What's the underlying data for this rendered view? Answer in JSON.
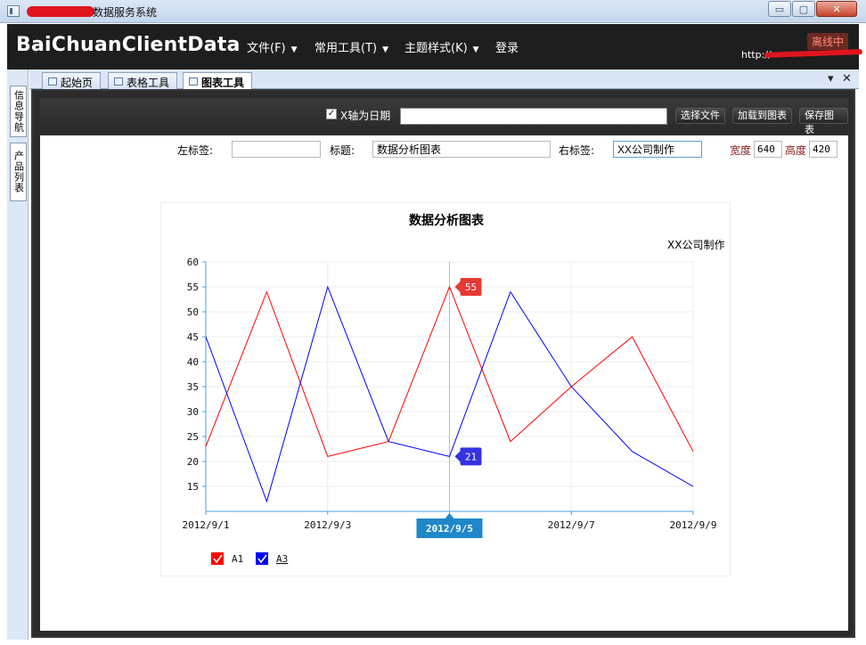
{
  "window": {
    "title": "数据服务系统",
    "min_glyph": "▭",
    "max_glyph": "▢",
    "close_glyph": "✕"
  },
  "header": {
    "brand": "BaiChuanClientData",
    "menus": [
      {
        "label": "文件(F)"
      },
      {
        "label": "常用工具(T)"
      },
      {
        "label": "主题样式(K)"
      },
      {
        "label": "登录"
      }
    ],
    "status": "离线中",
    "url_prefix": "http://"
  },
  "left_tabs": [
    {
      "label": "信息导航"
    },
    {
      "label": "产品列表"
    }
  ],
  "doc_tabs": [
    {
      "label": "起始页"
    },
    {
      "label": "表格工具"
    },
    {
      "label": "图表工具",
      "active": true
    }
  ],
  "doc_tab_controls": {
    "pin": "▾",
    "close": "✕"
  },
  "toolbar": {
    "x_is_date_label": "X轴为日期",
    "x_is_date_checked": true,
    "check_glyph": "✓",
    "file_path": "",
    "choose_file": "选择文件",
    "load_chart": "加载到图表",
    "save_chart": "保存图表"
  },
  "form": {
    "left_label_caption": "左标签:",
    "left_label_value": "",
    "title_caption": "标题:",
    "title_value": "数据分析图表",
    "right_label_caption": "右标签:",
    "right_label_value": "XX公司制作",
    "width_caption": "宽度",
    "width_value": "640",
    "height_caption": "高度",
    "height_value": "420"
  },
  "chart_data": {
    "type": "line",
    "title": "数据分析图表",
    "subtitle": "XX公司制作",
    "x": [
      "2012/9/1",
      "2012/9/2",
      "2012/9/3",
      "2012/9/4",
      "2012/9/5",
      "2012/9/6",
      "2012/9/7",
      "2012/9/8",
      "2012/9/9"
    ],
    "x_tick_labels": [
      "2012/9/1",
      "2012/9/3",
      "2012/9/5",
      "2012/9/7",
      "2012/9/9"
    ],
    "ylim": [
      10,
      60
    ],
    "y_ticks": [
      15,
      20,
      25,
      30,
      35,
      40,
      45,
      50,
      55,
      60
    ],
    "grid": true,
    "legend": "bottom-left",
    "series": [
      {
        "name": "A1",
        "color": "#ff0000",
        "values": [
          23,
          54,
          21,
          24,
          55,
          24,
          35,
          45,
          22
        ]
      },
      {
        "name": "A3",
        "color": "#0000ff",
        "values": [
          45,
          12,
          55,
          24,
          21,
          54,
          35,
          22,
          15
        ]
      }
    ],
    "crosshair": {
      "x": "2012/9/5",
      "label": "2012/9/5",
      "tooltips": [
        {
          "series": "A1",
          "value": "55",
          "color": "#e53935"
        },
        {
          "series": "A3",
          "value": "21",
          "color": "#3333e0"
        }
      ]
    }
  }
}
